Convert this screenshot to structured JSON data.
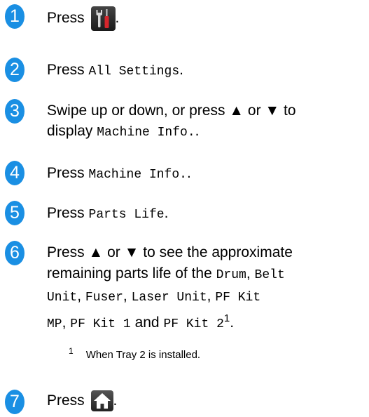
{
  "steps": [
    {
      "number": "1",
      "press": "Press",
      "after": "."
    },
    {
      "number": "2",
      "press": "Press",
      "code": "All Settings",
      "after": "."
    },
    {
      "number": "3",
      "line1": "Swipe up or down, or press ▲ or ▼ to",
      "line2_pre": "display",
      "code": "Machine Info.",
      "after": "."
    },
    {
      "number": "4",
      "press": "Press",
      "code": "Machine Info.",
      "after": "."
    },
    {
      "number": "5",
      "press": "Press",
      "code": "Parts Life",
      "after": "."
    },
    {
      "number": "6",
      "line1": "Press ▲ or ▼ to see the approximate",
      "line2_pre": "remaining parts life of the",
      "drum": "Drum",
      "comma": ",",
      "belt": "Belt",
      "unit": "Unit",
      "fuser": "Fuser",
      "laser": "Laser Unit",
      "pfkit": "PF Kit",
      "mp": "MP",
      "pfkit1": "PF Kit 1",
      "and": "and",
      "pfkit2": "PF Kit 2",
      "ref": "1",
      "after": "."
    },
    {
      "number": "7",
      "press": "Press",
      "after": "."
    }
  ],
  "footnote": {
    "mark": "1",
    "text": "When Tray 2 is installed."
  },
  "icons": {
    "step1": "settings-tools-icon",
    "step7": "home-icon"
  },
  "colors": {
    "step_badge": "#1a8fe3"
  }
}
